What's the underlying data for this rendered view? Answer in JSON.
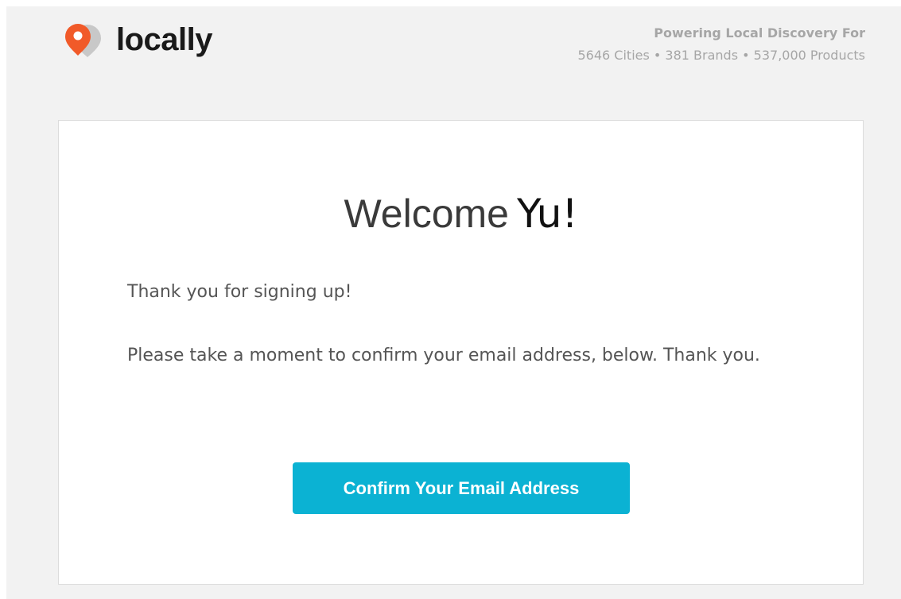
{
  "header": {
    "logo_text": "locally",
    "tagline_title": "Powering Local Discovery For",
    "tagline_stats": "5646 Cities • 381 Brands • 537,000 Products"
  },
  "card": {
    "welcome_prefix": "Welcome",
    "welcome_name": "Yu!",
    "paragraph_1": "Thank you for signing up!",
    "paragraph_2": "Please take a moment to confirm your email address, below. Thank you.",
    "cta_label": "Confirm Your Email Address"
  },
  "colors": {
    "background": "#f2f2f2",
    "card": "#ffffff",
    "button": "#0bb2d3",
    "logo_orange": "#f15a29",
    "logo_gray": "#c8c8c8"
  },
  "icons": {
    "logo": "locally-pin-logo-icon"
  }
}
